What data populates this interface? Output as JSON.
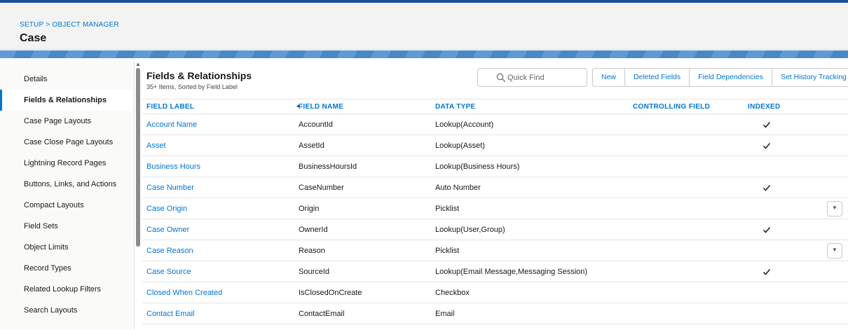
{
  "breadcrumb": {
    "setup": "SETUP",
    "separator": ">",
    "object_manager": "OBJECT MANAGER"
  },
  "page_title": "Case",
  "sidebar": {
    "items": [
      {
        "label": "Details",
        "active": false
      },
      {
        "label": "Fields & Relationships",
        "active": true
      },
      {
        "label": "Case Page Layouts",
        "active": false
      },
      {
        "label": "Case Close Page Layouts",
        "active": false
      },
      {
        "label": "Lightning Record Pages",
        "active": false
      },
      {
        "label": "Buttons, Links, and Actions",
        "active": false
      },
      {
        "label": "Compact Layouts",
        "active": false
      },
      {
        "label": "Field Sets",
        "active": false
      },
      {
        "label": "Object Limits",
        "active": false
      },
      {
        "label": "Record Types",
        "active": false
      },
      {
        "label": "Related Lookup Filters",
        "active": false
      },
      {
        "label": "Search Layouts",
        "active": false
      }
    ]
  },
  "main": {
    "title": "Fields & Relationships",
    "subtitle": "35+ Items, Sorted by Field Label",
    "quick_find_placeholder": "Quick Find",
    "buttons": {
      "new": "New",
      "deleted_fields": "Deleted Fields",
      "field_dependencies": "Field Dependencies",
      "set_history_tracking": "Set History Tracking"
    },
    "columns": {
      "field_label": "FIELD LABEL",
      "field_name": "FIELD NAME",
      "data_type": "DATA TYPE",
      "controlling_field": "CONTROLLING FIELD",
      "indexed": "INDEXED"
    },
    "rows": [
      {
        "label": "Account Name",
        "name": "AccountId",
        "type": "Lookup(Account)",
        "indexed": true,
        "menu": false
      },
      {
        "label": "Asset",
        "name": "AssetId",
        "type": "Lookup(Asset)",
        "indexed": true,
        "menu": false
      },
      {
        "label": "Business Hours",
        "name": "BusinessHoursId",
        "type": "Lookup(Business Hours)",
        "indexed": false,
        "menu": false
      },
      {
        "label": "Case Number",
        "name": "CaseNumber",
        "type": "Auto Number",
        "indexed": true,
        "menu": false
      },
      {
        "label": "Case Origin",
        "name": "Origin",
        "type": "Picklist",
        "indexed": false,
        "menu": true
      },
      {
        "label": "Case Owner",
        "name": "OwnerId",
        "type": "Lookup(User,Group)",
        "indexed": true,
        "menu": false
      },
      {
        "label": "Case Reason",
        "name": "Reason",
        "type": "Picklist",
        "indexed": false,
        "menu": true
      },
      {
        "label": "Case Source",
        "name": "SourceId",
        "type": "Lookup(Email Message,Messaging Session)",
        "indexed": true,
        "menu": false
      },
      {
        "label": "Closed When Created",
        "name": "IsClosedOnCreate",
        "type": "Checkbox",
        "indexed": false,
        "menu": false
      },
      {
        "label": "Contact Email",
        "name": "ContactEmail",
        "type": "Email",
        "indexed": false,
        "menu": false
      }
    ]
  },
  "colors": {
    "link": "#0176d3",
    "header_bg": "#f3f3f3",
    "band": "#4d8fcf",
    "top_line": "#1b5297"
  },
  "icons": {
    "search": "search-icon",
    "check": "check-icon",
    "sort": "sort-ascending-icon",
    "menu": "chevron-down-icon"
  }
}
